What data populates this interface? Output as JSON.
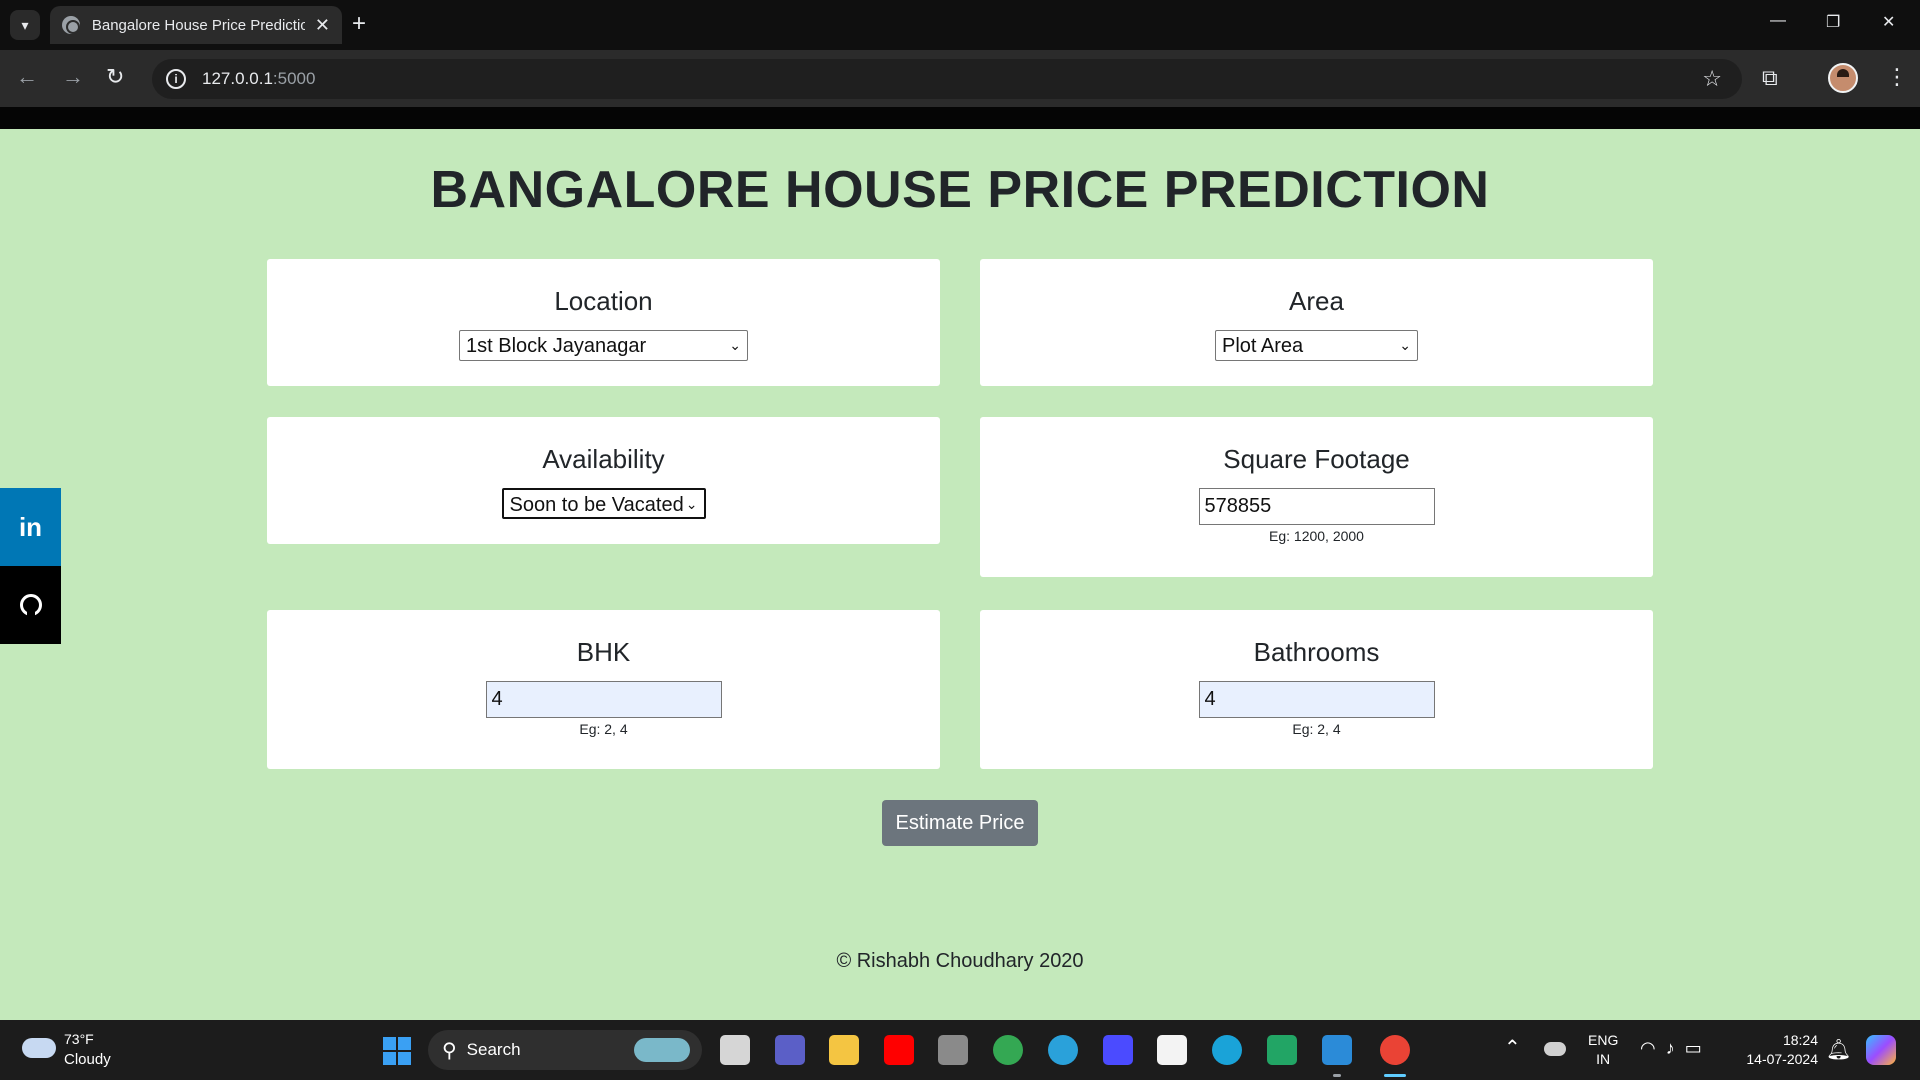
{
  "browser": {
    "tab_title": "Bangalore House Price Prediction",
    "url_host": "127.0.0.1",
    "url_port": ":5000"
  },
  "page": {
    "title": "BANGALORE HOUSE PRICE PREDICTION",
    "location": {
      "label": "Location",
      "selected": "1st Block Jayanagar"
    },
    "area": {
      "label": "Area",
      "selected": "Plot Area"
    },
    "availability": {
      "label": "Availability",
      "selected": "Soon to be Vacated"
    },
    "sqft": {
      "label": "Square Footage",
      "value": "578855",
      "hint": "Eg: 1200, 2000"
    },
    "bhk": {
      "label": "BHK",
      "value": "4",
      "hint": "Eg: 2, 4"
    },
    "bath": {
      "label": "Bathrooms",
      "value": "4",
      "hint": "Eg: 2, 4"
    },
    "estimate_label": "Estimate Price",
    "footer": "© Rishabh Choudhary 2020",
    "social": {
      "linkedin": "in"
    }
  },
  "taskbar": {
    "weather_temp": "73°F",
    "weather_desc": "Cloudy",
    "search_label": "Search",
    "lang_line1": "ENG",
    "lang_line2": "IN",
    "time": "18:24",
    "date": "14-07-2024"
  },
  "colors": {
    "page_bg": "#c4e9bb",
    "button_bg": "#6c757d",
    "linkedin": "#0077b5"
  }
}
